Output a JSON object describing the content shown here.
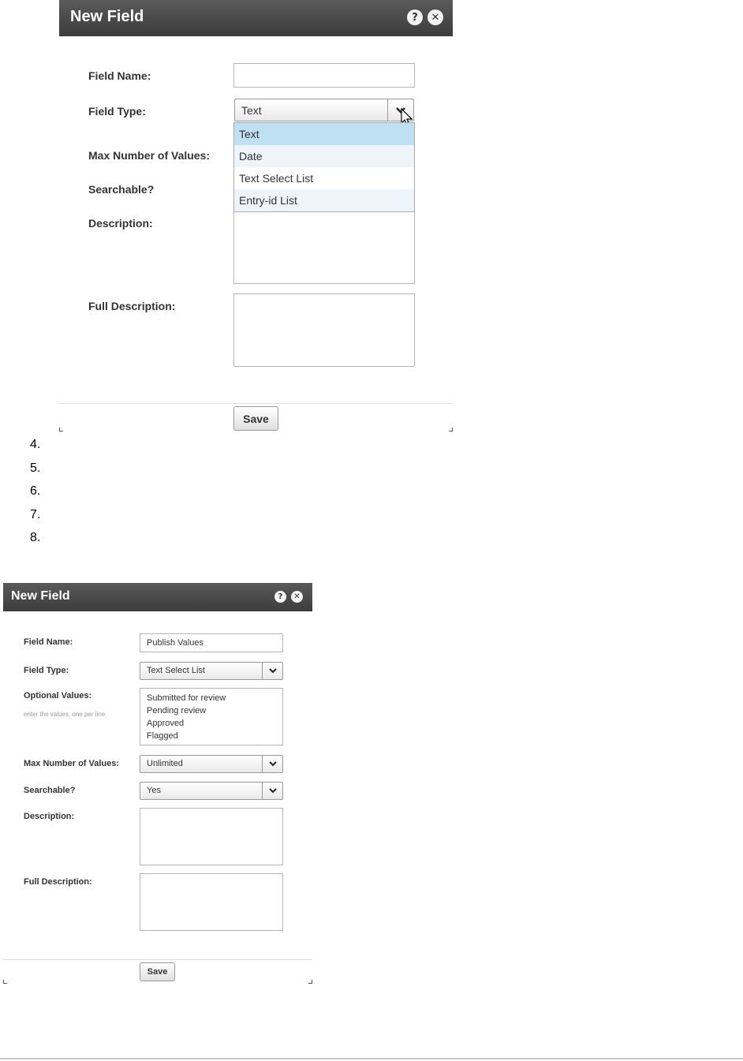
{
  "dialog1": {
    "title": "New Field",
    "help_icon": "help-icon",
    "close_icon": "close-icon",
    "field_name_label": "Field Name:",
    "field_name_value": "",
    "field_type_label": "Field Type:",
    "field_type_value": "Text",
    "max_values_label": "Max Number of Values:",
    "searchable_label": "Searchable?",
    "description_label": "Description:",
    "full_description_label": "Full Description:",
    "dropdown_options": [
      "Text",
      "Date",
      "Text Select List",
      "Entry-id List"
    ],
    "save_label": "Save"
  },
  "steps": [
    "4.",
    "5.",
    "6.",
    "7.",
    "8."
  ],
  "dialog2": {
    "title": "New Field",
    "field_name_label": "Field Name:",
    "field_name_value": "Publish Values",
    "field_type_label": "Field Type:",
    "field_type_value": "Text Select List",
    "optional_values_label": "Optional Values:",
    "optional_values_hint": "enter the values, one per line",
    "optional_values": [
      "Submitted for review",
      "Pending review",
      "Approved",
      "Flagged"
    ],
    "max_values_label": "Max Number of Values:",
    "max_values_value": "Unlimited",
    "searchable_label": "Searchable?",
    "searchable_value": "Yes",
    "description_label": "Description:",
    "full_description_label": "Full Description:",
    "save_label": "Save"
  }
}
